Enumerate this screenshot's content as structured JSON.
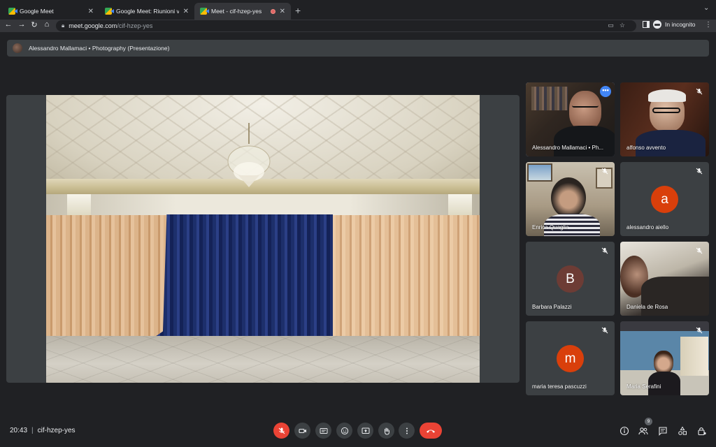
{
  "browser": {
    "tabs": [
      {
        "title": "Google Meet",
        "active": false
      },
      {
        "title": "Google Meet: Riunioni video e",
        "active": false
      },
      {
        "title": "Meet - cif-hzep-yes",
        "active": true,
        "recording": true
      }
    ],
    "url_host": "meet.google.com",
    "url_path": "/cif-hzep-yes",
    "incognito_label": "In incognito"
  },
  "presentation": {
    "banner_text": "Alessandro Mallamaci • Photography (Presentazione)"
  },
  "participants": [
    {
      "name": "Alessandro Mallamaci • Ph...",
      "type": "video",
      "active_speaker": true,
      "more_options": "•••"
    },
    {
      "name": "alfonso avvento",
      "type": "video",
      "muted": true
    },
    {
      "name": "Enrica Quaglia",
      "type": "video",
      "muted": true
    },
    {
      "name": "alessandro aiello",
      "type": "avatar",
      "letter": "a",
      "color": "#d93f0b",
      "muted": true
    },
    {
      "name": "Barbara Palazzi",
      "type": "avatar",
      "letter": "B",
      "color": "#6d3c35",
      "muted": true
    },
    {
      "name": "Daniela de Rosa",
      "type": "video",
      "muted": true
    },
    {
      "name": "maria teresa pascuzzi",
      "type": "avatar",
      "letter": "m",
      "color": "#d93f0b",
      "muted": true
    },
    {
      "name": "Maria Serafini",
      "type": "video",
      "muted": true
    }
  ],
  "bottom_bar": {
    "time": "20:43",
    "separator": "|",
    "meeting_code": "cif-hzep-yes",
    "participant_count": "9",
    "controls": [
      "mic-off",
      "camera",
      "captions",
      "emoji",
      "present",
      "raise-hand",
      "more",
      "leave-call"
    ]
  },
  "colors": {
    "background": "#202124",
    "tile": "#3c4043",
    "mic_off": "#ea4335",
    "accent": "#8ab4f8"
  }
}
